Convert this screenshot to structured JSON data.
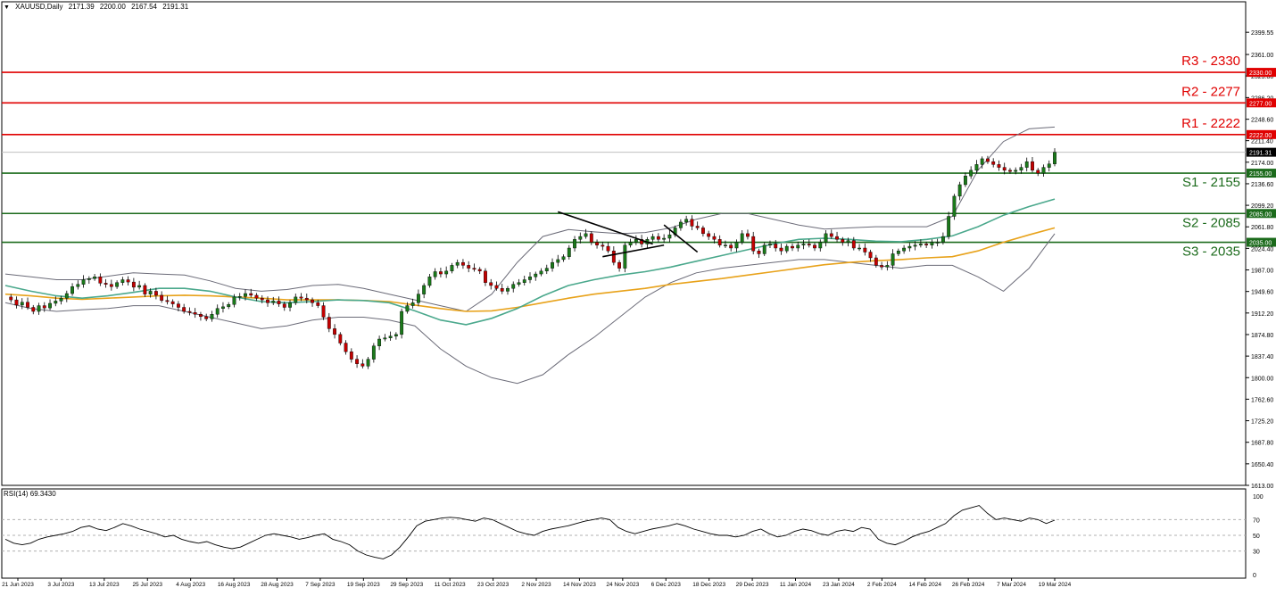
{
  "header": {
    "symbol": "XAUUSD,Daily",
    "open": "2171.39",
    "high": "2200.00",
    "low": "2167.54",
    "close": "2191.31"
  },
  "chart_data": [
    {
      "type": "candlestick",
      "title": "XAUUSD,Daily",
      "ylim": [
        1613.0,
        2437.0
      ],
      "y_ticks": [
        "2399.55",
        "2361.00",
        "2323.80",
        "2286.20",
        "2248.60",
        "2211.40",
        "2174.00",
        "2136.60",
        "2099.20",
        "2061.80",
        "2024.40",
        "1987.00",
        "1949.60",
        "1912.20",
        "1874.80",
        "1837.40",
        "1800.00",
        "1762.60",
        "1725.20",
        "1687.80",
        "1650.40",
        "1613.00"
      ],
      "x_labels": [
        "21 Jun 2023",
        "3 Jul 2023",
        "13 Jul 2023",
        "25 Jul 2023",
        "4 Aug 2023",
        "16 Aug 2023",
        "28 Aug 2023",
        "7 Sep 2023",
        "19 Sep 2023",
        "29 Sep 2023",
        "11 Oct 2023",
        "23 Oct 2023",
        "2 Nov 2023",
        "14 Nov 2023",
        "24 Nov 2023",
        "6 Dec 2023",
        "18 Dec 2023",
        "29 Dec 2023",
        "11 Jan 2024",
        "23 Jan 2024",
        "2 Feb 2024",
        "14 Feb 2024",
        "26 Feb 2024",
        "7 Mar 2024",
        "19 Mar 2024"
      ],
      "current_price": "2191.31",
      "levels": [
        {
          "label": "R3 - 2330",
          "value": 2330,
          "tag": "2330.00",
          "kind": "resistance"
        },
        {
          "label": "R2 - 2277",
          "value": 2277,
          "tag": "2277.00",
          "kind": "resistance"
        },
        {
          "label": "R1 - 2222",
          "value": 2222,
          "tag": "2222.00",
          "kind": "resistance"
        },
        {
          "label": "S1 - 2155",
          "value": 2155,
          "tag": "2155.00",
          "kind": "support"
        },
        {
          "label": "S2 - 2085",
          "value": 2085,
          "tag": "2085.00",
          "kind": "support"
        },
        {
          "label": "S3 - 2035",
          "value": 2035,
          "tag": "2035.00",
          "kind": "support"
        }
      ],
      "price_path": [
        1940,
        1935,
        1926,
        1931,
        1922,
        1915,
        1925,
        1921,
        1929,
        1933,
        1938,
        1946,
        1958,
        1962,
        1970,
        1972,
        1975,
        1964,
        1962,
        1958,
        1965,
        1970,
        1966,
        1957,
        1960,
        1945,
        1950,
        1943,
        1934,
        1932,
        1928,
        1922,
        1915,
        1913,
        1910,
        1906,
        1902,
        1910,
        1920,
        1923,
        1927,
        1940,
        1941,
        1946,
        1943,
        1938,
        1935,
        1930,
        1933,
        1928,
        1922,
        1930,
        1940,
        1938,
        1935,
        1930,
        1925,
        1905,
        1885,
        1875,
        1860,
        1845,
        1832,
        1824,
        1820,
        1832,
        1855,
        1867,
        1869,
        1872,
        1875,
        1915,
        1925,
        1930,
        1945,
        1960,
        1975,
        1984,
        1980,
        1985,
        1995,
        2000,
        1995,
        1990,
        1988,
        1985,
        1965,
        1960,
        1955,
        1950,
        1955,
        1962,
        1965,
        1970,
        1975,
        1980,
        1985,
        1990,
        2000,
        2005,
        2010,
        2025,
        2040,
        2045,
        2050,
        2035,
        2030,
        2028,
        2020,
        2000,
        1990,
        2030,
        2035,
        2040,
        2032,
        2040,
        2045,
        2040,
        2042,
        2048,
        2060,
        2070,
        2075,
        2063,
        2060,
        2050,
        2045,
        2040,
        2030,
        2030,
        2025,
        2035,
        2050,
        2045,
        2020,
        2015,
        2030,
        2032,
        2025,
        2020,
        2028,
        2025,
        2030,
        2032,
        2030,
        2025,
        2035,
        2050,
        2045,
        2040,
        2035,
        2038,
        2025,
        2025,
        2018,
        2008,
        1995,
        1992,
        1995,
        2015,
        2020,
        2025,
        2028,
        2030,
        2032,
        2030,
        2035,
        2035,
        2045,
        2080,
        2115,
        2135,
        2150,
        2160,
        2170,
        2180,
        2175,
        2170,
        2165,
        2160,
        2158,
        2160,
        2165,
        2175,
        2160,
        2155,
        2165,
        2171,
        2191.31
      ],
      "ma_fast": [
        1960,
        1950,
        1942,
        1938,
        1942,
        1948,
        1955,
        1955,
        1950,
        1940,
        1932,
        1930,
        1932,
        1935,
        1934,
        1930,
        1916,
        1900,
        1892,
        1903,
        1920,
        1942,
        1960,
        1970,
        1978,
        1984,
        1992,
        2002,
        2012,
        2022,
        2032,
        2040,
        2042,
        2040,
        2037,
        2036,
        2040,
        2046,
        2062,
        2082,
        2097,
        2110
      ],
      "ma_slow": [
        1945,
        1942,
        1938,
        1936,
        1938,
        1940,
        1942,
        1943,
        1942,
        1940,
        1938,
        1935,
        1935,
        1935,
        1934,
        1932,
        1926,
        1920,
        1915,
        1916,
        1922,
        1930,
        1938,
        1945,
        1950,
        1955,
        1962,
        1967,
        1972,
        1978,
        1984,
        1990,
        1996,
        2000,
        2003,
        2005,
        2008,
        2010,
        2020,
        2035,
        2048,
        2060
      ],
      "bb_upper": [
        1980,
        1975,
        1970,
        1970,
        1976,
        1982,
        1980,
        1978,
        1968,
        1955,
        1950,
        1953,
        1960,
        1962,
        1955,
        1945,
        1935,
        1925,
        1915,
        1945,
        2000,
        2045,
        2057,
        2053,
        2050,
        2052,
        2060,
        2075,
        2085,
        2085,
        2075,
        2065,
        2058,
        2060,
        2062,
        2062,
        2062,
        2080,
        2160,
        2210,
        2232,
        2235
      ],
      "bb_lower": [
        1930,
        1920,
        1915,
        1918,
        1920,
        1925,
        1925,
        1915,
        1905,
        1895,
        1885,
        1890,
        1900,
        1905,
        1905,
        1900,
        1890,
        1850,
        1820,
        1800,
        1790,
        1805,
        1840,
        1870,
        1905,
        1940,
        1965,
        1982,
        1990,
        1995,
        2000,
        2005,
        2005,
        2000,
        1995,
        1990,
        1995,
        1995,
        1975,
        1950,
        1990,
        2050
      ]
    },
    {
      "type": "line",
      "title": "RSI(14) 69.3430",
      "ylim": [
        0,
        100
      ],
      "y_ticks": [
        "100",
        "70",
        "50",
        "30",
        "0"
      ],
      "levels": [
        70,
        50,
        30
      ],
      "values": [
        45,
        40,
        38,
        40,
        45,
        48,
        50,
        52,
        55,
        60,
        62,
        58,
        56,
        60,
        65,
        62,
        58,
        55,
        52,
        48,
        50,
        45,
        42,
        40,
        42,
        38,
        35,
        33,
        35,
        40,
        45,
        50,
        52,
        50,
        48,
        45,
        47,
        50,
        52,
        45,
        42,
        38,
        30,
        25,
        22,
        20,
        25,
        35,
        48,
        62,
        68,
        70,
        72,
        73,
        72,
        70,
        68,
        72,
        70,
        65,
        60,
        55,
        52,
        50,
        55,
        58,
        60,
        62,
        65,
        68,
        70,
        72,
        70,
        60,
        55,
        52,
        55,
        58,
        60,
        62,
        65,
        62,
        58,
        55,
        52,
        50,
        50,
        48,
        50,
        55,
        58,
        52,
        48,
        50,
        55,
        58,
        56,
        52,
        50,
        55,
        57,
        55,
        60,
        58,
        45,
        40,
        38,
        42,
        48,
        52,
        55,
        60,
        65,
        75,
        82,
        85,
        88,
        78,
        70,
        72,
        70,
        68,
        72,
        70,
        65,
        69.343
      ]
    }
  ]
}
